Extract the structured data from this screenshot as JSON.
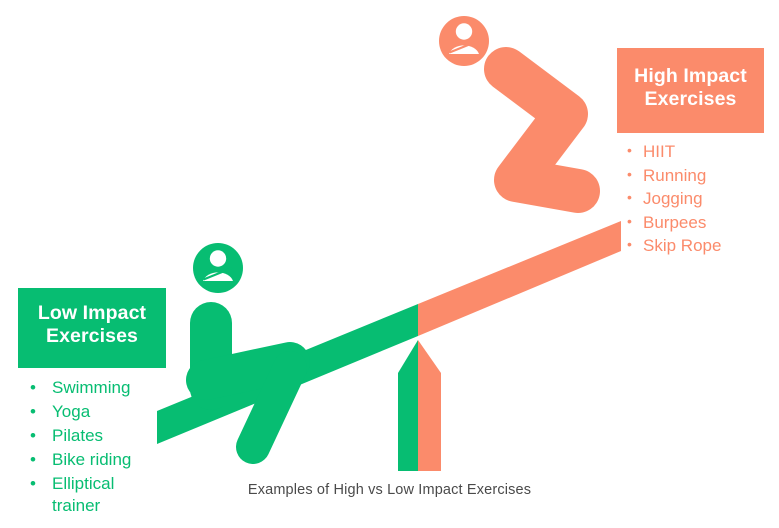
{
  "caption": "Examples of High vs Low Impact Exercises",
  "colors": {
    "green": "#07bd72",
    "orange": "#fb8b6b",
    "background": "#ffffff",
    "caption_text": "#4a4a4a",
    "header_text": "#ffffff"
  },
  "panels": {
    "low": {
      "title_line1": "Low Impact",
      "title_line2": "Exercises",
      "bullet_glyph": "•",
      "items": [
        "Swimming",
        "Yoga",
        "Pilates",
        "Bike riding",
        "Elliptical trainer"
      ]
    },
    "high": {
      "title_line1": "High Impact",
      "title_line2": "Exercises",
      "bullet_glyph": "•",
      "items": [
        "HIIT",
        "Running",
        "Jogging",
        "Burpees",
        "Skip Rope"
      ]
    }
  },
  "illustration": {
    "type": "seesaw",
    "plank_left_color": "#07bd72",
    "plank_right_color": "#fb8b6b",
    "fulcrum_left_color": "#07bd72",
    "fulcrum_right_color": "#fb8b6b",
    "low_side_figure_color": "#07bd72",
    "high_side_figure_color": "#fb8b6b",
    "low_side_figure_pose": "seated",
    "high_side_figure_pose": "crouched-zigzag"
  }
}
